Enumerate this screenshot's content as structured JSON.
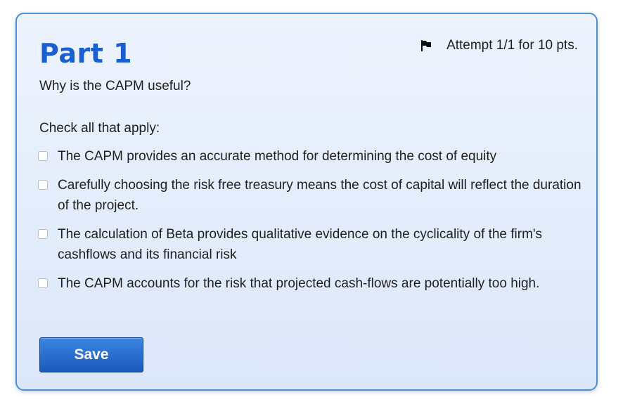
{
  "part": {
    "title": "Part 1",
    "attempt_text": "Attempt 1/1 for 10 pts.",
    "flag_icon": "flag-icon"
  },
  "question": {
    "prompt": "Why is the CAPM useful?",
    "instructions": "Check all that apply:",
    "options": [
      {
        "label": "The CAPM provides an accurate method for determining the cost of equity",
        "checked": false
      },
      {
        "label": "Carefully choosing the risk free treasury means the cost of capital will reflect the duration of the project.",
        "checked": false
      },
      {
        "label": "The calculation of Beta provides qualitative evidence on the cyclicality of the firm's cashflows and its financial risk",
        "checked": false
      },
      {
        "label": "The CAPM accounts for the risk that projected cash-flows are potentially too high.",
        "checked": false
      }
    ]
  },
  "actions": {
    "save_label": "Save"
  },
  "colors": {
    "title": "#1a5fd1",
    "card_border": "#4a8fd6",
    "button": "#1a58bd"
  }
}
